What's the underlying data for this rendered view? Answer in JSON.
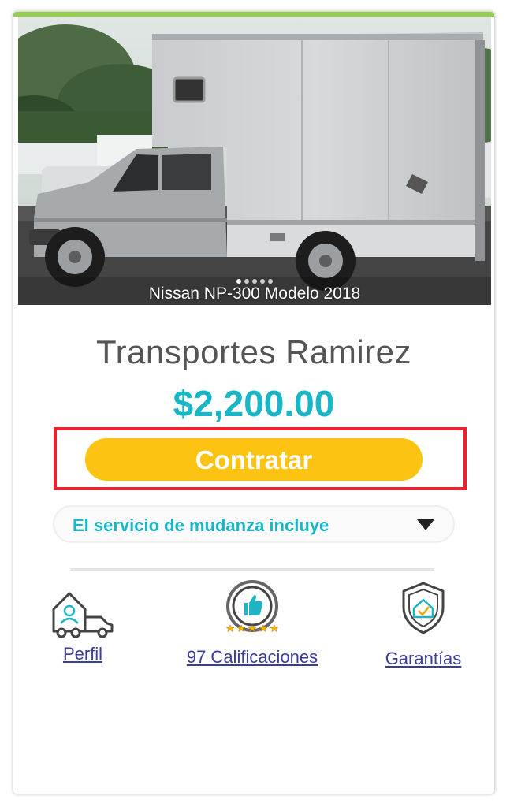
{
  "photo": {
    "caption": "Nissan NP-300 Modelo 2018",
    "slides": 5,
    "active_slide": 1
  },
  "provider": {
    "name": "Transportes Ramirez",
    "price": "$2,200.00"
  },
  "actions": {
    "hire_label": "Contratar",
    "includes_label": "El servicio de mudanza incluye"
  },
  "features": {
    "profile": {
      "label": "Perfil",
      "icon": "house-truck-icon"
    },
    "ratings": {
      "label": "97 Calificaciones",
      "icon": "thumbs-up-badge-icon",
      "stars": 5
    },
    "guarantees": {
      "label": "Garantías",
      "icon": "shield-house-icon"
    }
  },
  "colors": {
    "accent": "#18b6c6",
    "button": "#fcc312",
    "highlight": "#e8232f",
    "top_bar": "#93d04a",
    "link": "#3a3d9a"
  }
}
